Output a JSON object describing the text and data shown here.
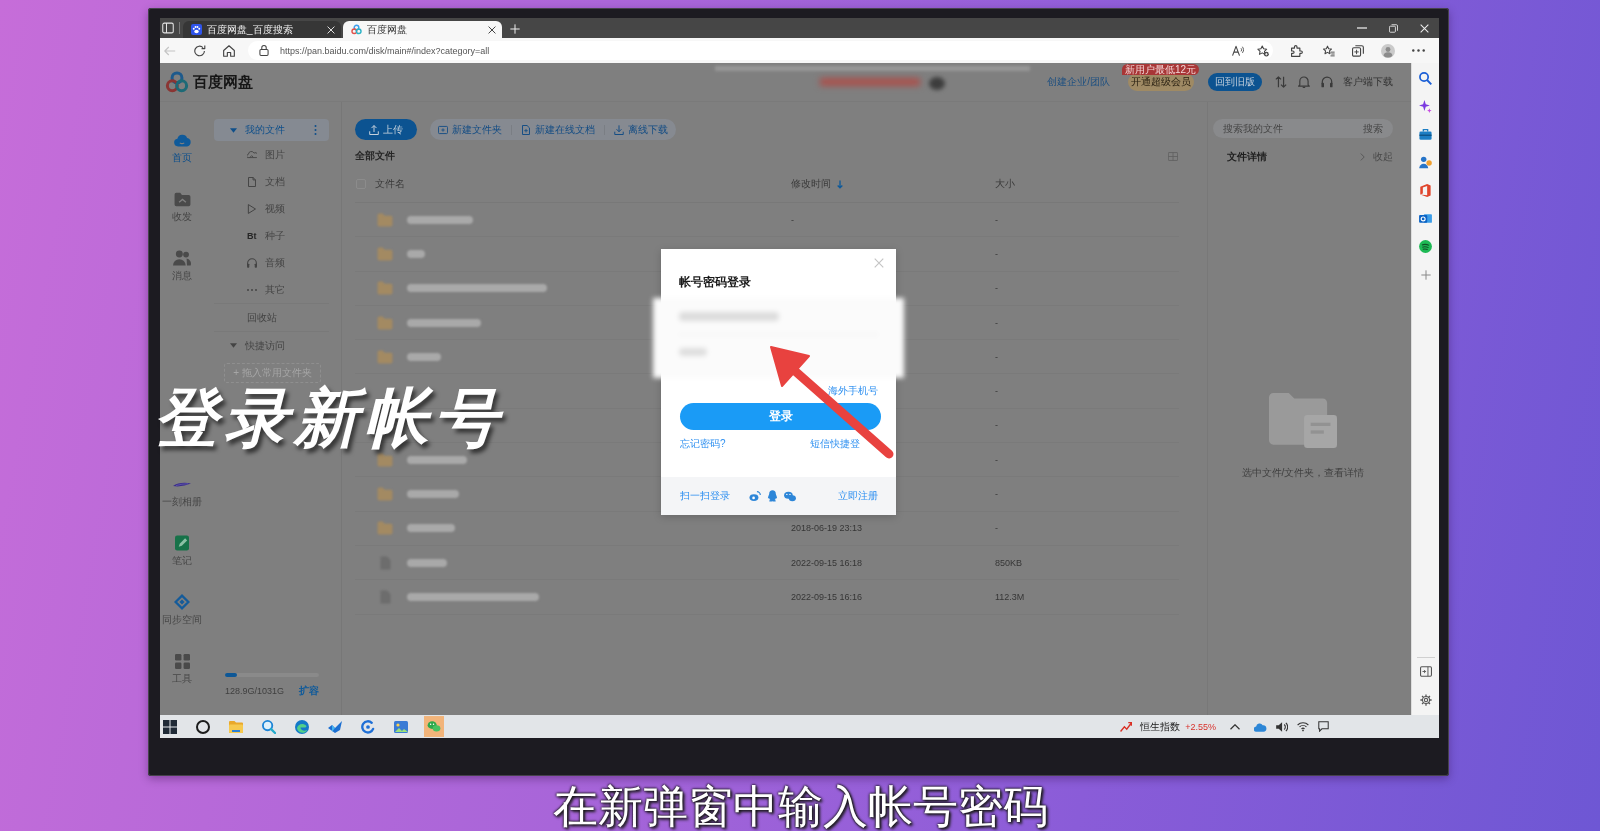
{
  "browser": {
    "tabs": [
      {
        "title": "百度网盘_百度搜索",
        "kind": "paw",
        "selected": false
      },
      {
        "title": "百度网盘",
        "kind": "rings",
        "selected": true
      }
    ],
    "url": "https://pan.baidu.com/disk/main#/index?category=all"
  },
  "header": {
    "logo": "百度网盘",
    "team_link": "创建企业/团队",
    "vip_button": "开通超级会员",
    "vip_badge": "新用户最低12元",
    "old_version_button": "回到旧版",
    "download_link": "客户端下载"
  },
  "nav": [
    {
      "label": "首页",
      "kind": "home",
      "selected": true
    },
    {
      "label": "收发",
      "kind": "transfer",
      "selected": false
    },
    {
      "label": "消息",
      "kind": "people",
      "selected": false
    },
    {
      "label": "一刻相册",
      "kind": "album",
      "selected": false
    },
    {
      "label": "笔记",
      "kind": "note",
      "selected": false
    },
    {
      "label": "同步空间",
      "kind": "sync",
      "selected": false
    },
    {
      "label": "工具",
      "kind": "tools",
      "selected": false
    }
  ],
  "sidebar": {
    "items": [
      {
        "label": "我的文件",
        "kind": "group",
        "expanded": true,
        "selected": true,
        "children": [
          {
            "label": "图片",
            "kind": "image",
            "selected": false
          },
          {
            "label": "文档",
            "kind": "doc",
            "selected": false
          },
          {
            "label": "视频",
            "kind": "video",
            "selected": false
          },
          {
            "label": "种子",
            "kind": "bt",
            "glyph": "Bt",
            "selected": false
          },
          {
            "label": "音频",
            "kind": "audio",
            "selected": false
          },
          {
            "label": "其它",
            "kind": "other",
            "selected": false
          }
        ]
      },
      {
        "label": "回收站",
        "kind": "plain",
        "selected": false
      },
      {
        "label": "快捷访问",
        "kind": "group",
        "expanded": true,
        "selected": false
      }
    ],
    "drop_hint": "+ 拖入常用文件夹",
    "storage": {
      "level": 0.125,
      "text": "128.9G/1031G",
      "action": "扩容"
    }
  },
  "toolbar": {
    "upload": "上传",
    "actions": [
      {
        "label": "新建文件夹",
        "kind": "folder"
      },
      {
        "label": "新建在线文档",
        "kind": "doc"
      },
      {
        "label": "离线下载",
        "kind": "download"
      }
    ]
  },
  "breadcrumb": "全部文件",
  "table": {
    "checked": false,
    "columns": [
      {
        "label": "文件名",
        "sorted": false
      },
      {
        "label": "修改时间",
        "sorted": true
      },
      {
        "label": "大小",
        "sorted": false
      }
    ],
    "rows": [
      {
        "kind": "folder",
        "modified": "-",
        "size": "-"
      },
      {
        "kind": "folder",
        "size": "-"
      },
      {
        "kind": "folder",
        "size": "-"
      },
      {
        "kind": "folder",
        "size": "-"
      },
      {
        "kind": "folder",
        "size": "-"
      },
      {
        "size": "-"
      },
      {
        "size": "-"
      },
      {
        "kind": "folder",
        "size": "-"
      },
      {
        "kind": "folder",
        "size": "-"
      },
      {
        "kind": "folder",
        "modified": "2018-06-19 23:13",
        "size": "-"
      },
      {
        "kind": "file",
        "modified": "2022-09-15 16:18",
        "size": "850KB"
      },
      {
        "kind": "file",
        "modified": "2022-09-15 16:16",
        "size": "112.3M"
      }
    ]
  },
  "details": {
    "search_placeholder": "搜索我的文件",
    "search_button": "搜索",
    "title": "文件详情",
    "collapse": "收起",
    "empty_text": "选中文件/文件夹，查看详情"
  },
  "dialog": {
    "title": "帐号密码登录",
    "overseas_link": "海外手机号",
    "login_button": "登录",
    "forgot_link": "忘记密码?",
    "sms_link": "短信快捷登",
    "qr_link": "扫一扫登录",
    "register_link": "立即注册"
  },
  "taskbar": {
    "apps": [
      {
        "kind": "start",
        "flashing": false
      },
      {
        "kind": "ring",
        "flashing": false
      },
      {
        "kind": "files",
        "flashing": false
      },
      {
        "kind": "finder",
        "flashing": false
      },
      {
        "kind": "browser",
        "flashing": false
      },
      {
        "kind": "bird",
        "flashing": false
      },
      {
        "kind": "arc",
        "flashing": false
      },
      {
        "kind": "photos",
        "flashing": false
      },
      {
        "kind": "chat",
        "flashing": true
      }
    ],
    "stock": {
      "name": "恒生指数",
      "change": "+2.55%"
    }
  },
  "captions": {
    "title": "登录新帐号",
    "subtitle": "在新弹窗中输入帐号密码"
  }
}
